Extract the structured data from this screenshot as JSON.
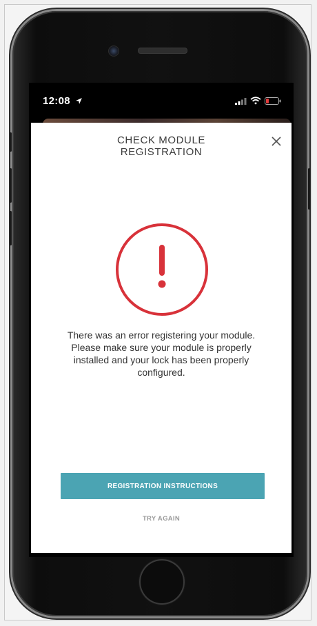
{
  "status_bar": {
    "time": "12:08",
    "location_icon": "location-arrow-icon",
    "signal_icon": "cellular-signal-icon",
    "wifi_icon": "wifi-icon",
    "battery_icon": "battery-low-icon",
    "battery_level": 0.15
  },
  "modal": {
    "title": "CHECK MODULE REGISTRATION",
    "close_icon": "close-icon",
    "alert_icon": "exclamation-circle-icon",
    "message": "There was an error registering your module. Please make sure your module is properly installed and your lock has been properly configured.",
    "primary_button": "REGISTRATION INSTRUCTIONS",
    "secondary_button": "TRY AGAIN"
  },
  "colors": {
    "accent": "#4ba4b3",
    "alert": "#d8323a",
    "battery_low": "#e33b3b",
    "link": "#9a9a9a"
  }
}
